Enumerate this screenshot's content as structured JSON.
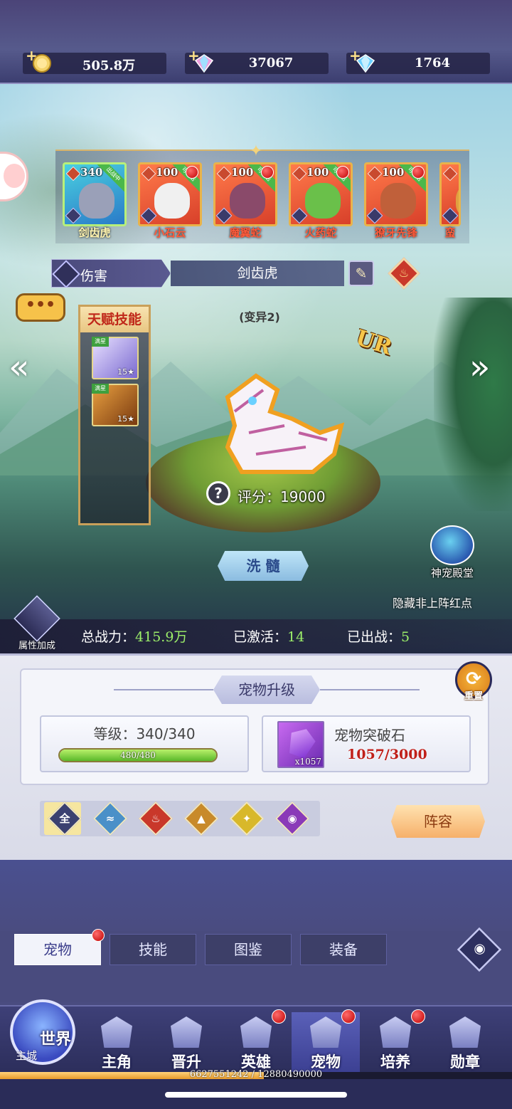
{
  "currencies": [
    {
      "icon": "gold-coin-icon",
      "value": "505.8万"
    },
    {
      "icon": "rainbow-diamond-icon",
      "value": "37067"
    },
    {
      "icon": "blue-diamond-icon",
      "value": "1764"
    }
  ],
  "pets": [
    {
      "name": "剑齿虎",
      "level": "340",
      "tag": "出战中",
      "selected": true,
      "color": "#9aa0b8"
    },
    {
      "name": "小石云",
      "level": "100",
      "tag": "可激活",
      "color": "#f0f0f0"
    },
    {
      "name": "魔翼蛇",
      "level": "100",
      "tag": "可激活",
      "color": "#8a4a6a"
    },
    {
      "name": "火药蛇",
      "level": "100",
      "tag": "可激活",
      "color": "#6ac04a"
    },
    {
      "name": "獠牙先锋",
      "level": "100",
      "tag": "可激活",
      "color": "#c0603a"
    },
    {
      "name": "蛮",
      "level": "",
      "tag": "",
      "color": "#e0a040"
    }
  ],
  "pet_info": {
    "type_label": "伤害",
    "name": "剑齿虎",
    "edit_icon": "quill-icon",
    "element_icon": "fire-icon",
    "mutation": "(变异2)",
    "rarity": "UR",
    "score_label": "评分：",
    "score_value": "19000"
  },
  "talent": {
    "title": "天赋技能",
    "skills": [
      {
        "badge": "满星",
        "level": "15★"
      },
      {
        "badge": "满星",
        "level": "15★"
      }
    ]
  },
  "actions": {
    "wash": "洗 髓",
    "shrine": "神宠殿堂",
    "hide_red_dot": "隐藏非上阵红点",
    "attr_bonus": "属性加成"
  },
  "stats": {
    "power_label": "总战力：",
    "power_value": "415.9万",
    "activated_label": "已激活：",
    "activated_value": "14",
    "deployed_label": "已出战：",
    "deployed_value": "5"
  },
  "upgrade": {
    "title": "宠物升级",
    "reset": "重置",
    "level_label": "等级：",
    "level_value": "340/340",
    "exp_text": "480/480",
    "exp_fraction": 1.0,
    "stone_name": "宠物突破石",
    "stone_qty": "x1057",
    "stone_count": "1057/3000"
  },
  "filters": [
    {
      "label": "全",
      "color": "#3a4070"
    },
    {
      "label": "≈",
      "color": "#4a90c8"
    },
    {
      "label": "♨",
      "color": "#c9382a"
    },
    {
      "label": "▲",
      "color": "#c88a2a"
    },
    {
      "label": "✦",
      "color": "#d8b82a"
    },
    {
      "label": "◉",
      "color": "#8a3ab8"
    }
  ],
  "lineup": "阵容",
  "subtabs": [
    {
      "label": "宠物",
      "active": true,
      "dot": true
    },
    {
      "label": "技能"
    },
    {
      "label": "图鉴"
    },
    {
      "label": "装备"
    }
  ],
  "nav": {
    "world": "世界",
    "world_sub": "主城",
    "items": [
      {
        "label": "主角"
      },
      {
        "label": "晋升"
      },
      {
        "label": "英雄",
        "dot": true
      },
      {
        "label": "宠物",
        "dot": true,
        "active": true
      },
      {
        "label": "培养",
        "dot": true
      },
      {
        "label": "勋章"
      }
    ]
  },
  "exp_strip": {
    "text": "6627551242 / 12880490000",
    "fraction": 0.515
  }
}
